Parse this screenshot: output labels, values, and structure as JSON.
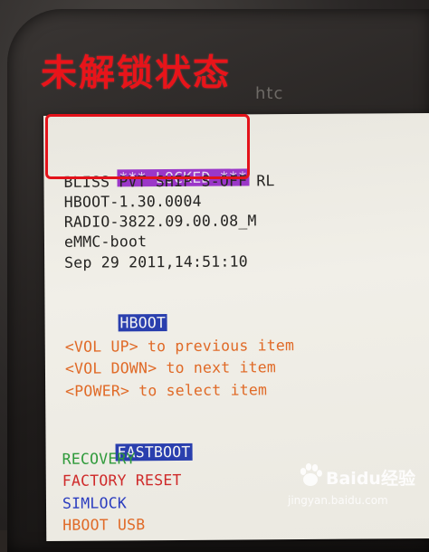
{
  "caption": "未解锁状态",
  "htc_logo": "htc",
  "bootloader": {
    "locked_banner": "*** LOCKED ***",
    "info_lines": [
      "BLISS PVT SHIP S-OFF RL",
      "HBOOT-1.30.0004",
      "RADIO-3822.09.00.08_M",
      "eMMC-boot",
      "Sep 29 2011,14:51:10"
    ],
    "section_title": "HBOOT",
    "instructions": [
      "<VOL UP> to previous item",
      "<VOL DOWN> to next item",
      "<POWER> to select item"
    ],
    "menu": [
      {
        "label": "FASTBOOT",
        "color": "#f3f3f3",
        "selected": true
      },
      {
        "label": "RECOVERY",
        "color": "#2e9a3a"
      },
      {
        "label": "FACTORY RESET",
        "color": "#cf2a2a"
      },
      {
        "label": "SIMLOCK",
        "color": "#2b3dbf"
      },
      {
        "label": "HBOOT USB",
        "color": "#e06a27"
      }
    ]
  },
  "watermark": {
    "brand": "Baidu经验",
    "url": "jingyan.baidu.com"
  },
  "colors": {
    "caption_red": "#e8141a",
    "locked_bg": "#9b37c8",
    "selected_bg": "#2a3fae",
    "instruction_orange": "#e06a27"
  }
}
